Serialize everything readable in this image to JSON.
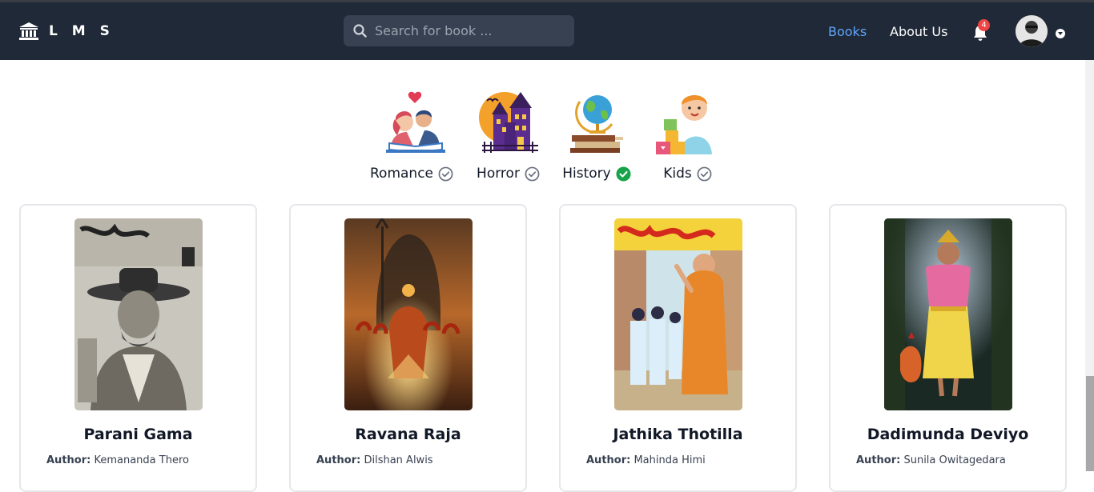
{
  "header": {
    "brand": "L M S",
    "search_placeholder": "Search for book ...",
    "nav": {
      "books": "Books",
      "about": "About Us"
    },
    "notification_count": "4",
    "colors": {
      "bar": "#1f2937",
      "active_link": "#60a5fa",
      "badge": "#ef4444"
    }
  },
  "categories": [
    {
      "label": "Romance",
      "selected": false,
      "icon": "romance-illustration"
    },
    {
      "label": "Horror",
      "selected": false,
      "icon": "haunted-house-illustration"
    },
    {
      "label": "History",
      "selected": true,
      "icon": "globe-books-illustration"
    },
    {
      "label": "Kids",
      "selected": false,
      "icon": "child-blocks-illustration"
    }
  ],
  "books": [
    {
      "title": "Parani Gama",
      "author_label": "Author:",
      "author": "Kemananda Thero"
    },
    {
      "title": "Ravana Raja",
      "author_label": "Author:",
      "author": "Dilshan Alwis"
    },
    {
      "title": "Jathika Thotilla",
      "author_label": "Author:",
      "author": "Mahinda Himi"
    },
    {
      "title": "Dadimunda Deviyo",
      "author_label": "Author:",
      "author": "Sunila Owitagedara"
    }
  ]
}
